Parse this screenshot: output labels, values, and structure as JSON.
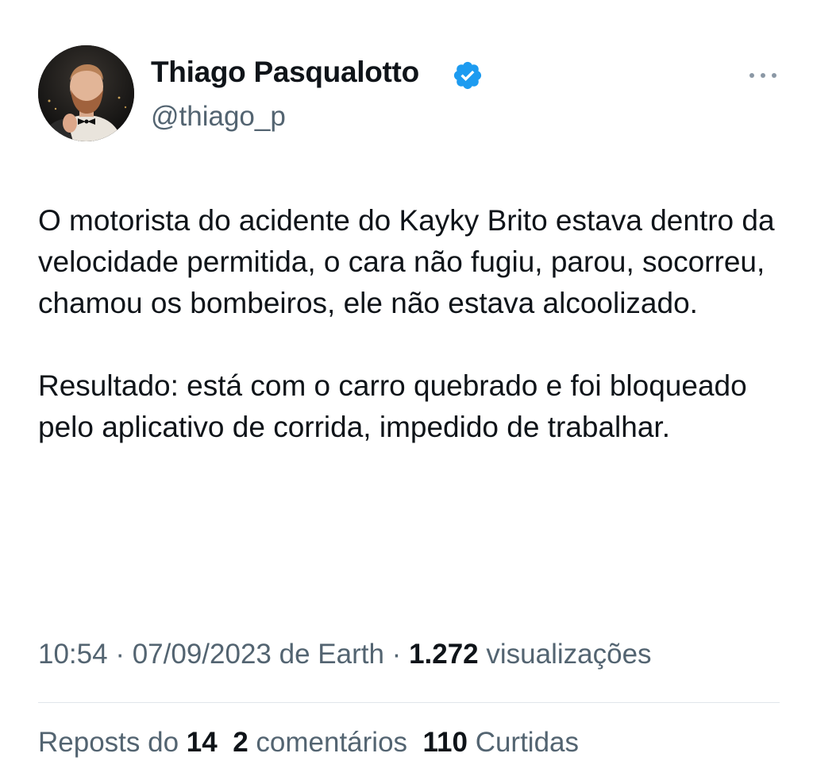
{
  "author": {
    "name": "Thiago Pasqualotto",
    "handle": "@thiago_p",
    "verified": true
  },
  "tweet": {
    "paragraphs": [
      "O motorista do acidente do Kayky Brito estava dentro da velocidade permitida, o cara não fugiu, parou, socorreu, chamou os bombeiros, ele não estava alcoolizado.",
      "Resultado: está com o carro quebrado e foi bloqueado pelo aplicativo de corrida, impedido de trabalhar."
    ],
    "time": "10:54",
    "separator": "·",
    "date": "07/09/2023",
    "source_prefix": "de",
    "source": "Earth",
    "views_count": "1.272",
    "views_label": "visualizações"
  },
  "stats": {
    "reposts_label": "Reposts do",
    "reposts_count": "14",
    "comments_count": "2",
    "comments_label": "comentários",
    "likes_count": "110",
    "likes_label": "Curtidas"
  },
  "colors": {
    "text": "#0f1419",
    "secondary": "#536471",
    "verified": "#1d9bf0",
    "divider": "#e1e6ea"
  },
  "icons": {
    "verified": "verified-badge-icon",
    "more": "more-horizontal-icon"
  }
}
